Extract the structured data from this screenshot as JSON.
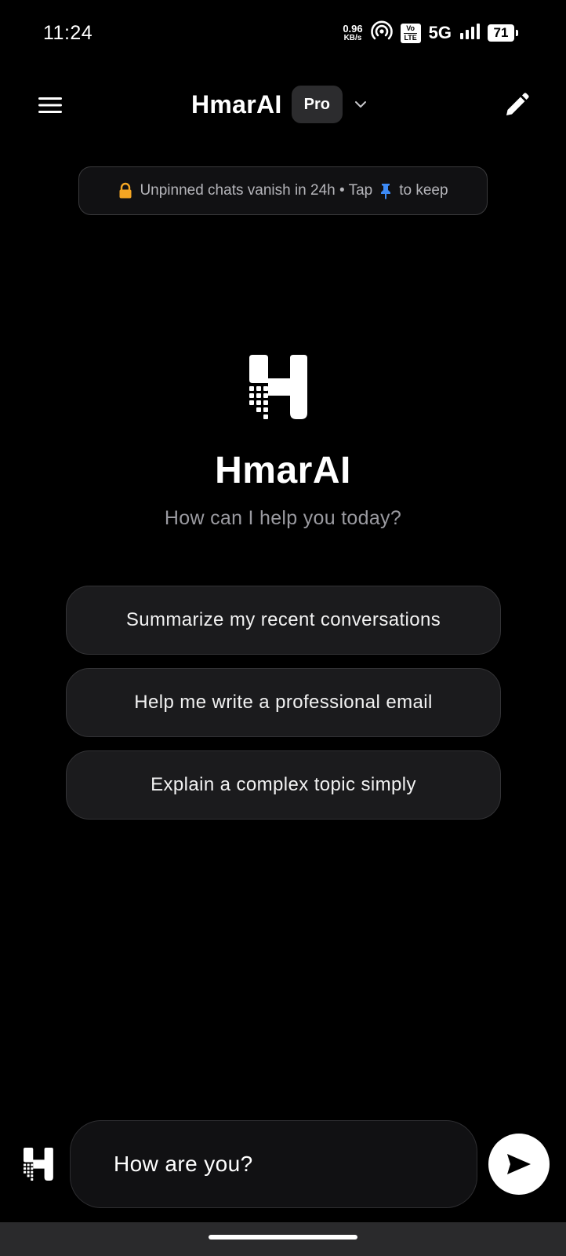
{
  "status_bar": {
    "time": "11:24",
    "net_speed_value": "0.96",
    "net_speed_unit": "KB/s",
    "volte_top": "Vo",
    "volte_bottom": "LTE",
    "network": "5G",
    "battery": "71",
    "icons": [
      "hotspot-icon",
      "volte-icon",
      "signal-icon",
      "battery-icon"
    ]
  },
  "header": {
    "title": "HmarAI",
    "badge": "Pro",
    "icons": [
      "menu-icon",
      "chevron-down-icon",
      "pencil-icon"
    ]
  },
  "notice": {
    "text_before": "Unpinned chats vanish in 24h • Tap",
    "text_after": "to keep",
    "icons": [
      "lock-icon",
      "pin-icon"
    ],
    "lock_color": "#f5a623",
    "pin_color": "#3d8bf7"
  },
  "hero": {
    "brand": "HmarAI",
    "tagline": "How can I help you today?"
  },
  "suggestions": [
    "Summarize my recent conversations",
    "Help me write a professional email",
    "Explain a complex topic simply"
  ],
  "composer": {
    "value": "How are you?",
    "icons": [
      "hmar-logo-icon",
      "send-icon"
    ]
  }
}
